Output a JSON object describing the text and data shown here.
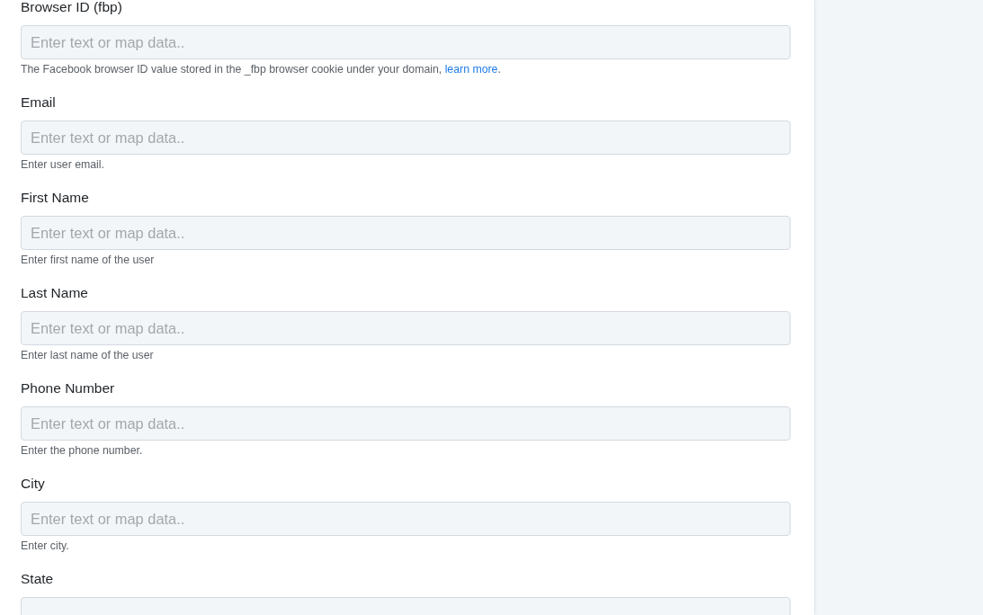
{
  "form": {
    "fields": [
      {
        "label": "Browser ID (fbp)",
        "placeholder": "Enter text or map data..",
        "help": "The Facebook browser ID value stored in the _fbp browser cookie under your domain, ",
        "help_link": "learn more",
        "help_after": "."
      },
      {
        "label": "Email",
        "placeholder": "Enter text or map data..",
        "help": "Enter user email."
      },
      {
        "label": "First Name",
        "placeholder": "Enter text or map data..",
        "help": "Enter first name of the user"
      },
      {
        "label": "Last Name",
        "placeholder": "Enter text or map data..",
        "help": "Enter last name of the user"
      },
      {
        "label": "Phone Number",
        "placeholder": "Enter text or map data..",
        "help": "Enter the phone number."
      },
      {
        "label": "City",
        "placeholder": "Enter text or map data..",
        "help": "Enter city."
      },
      {
        "label": "State"
      }
    ]
  }
}
